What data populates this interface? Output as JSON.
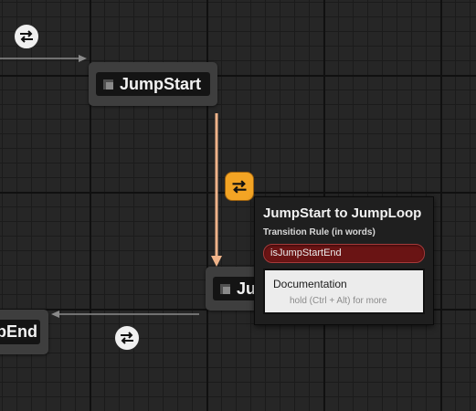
{
  "graph": {
    "background_color": "#262626",
    "wire_color": "#8a8a8a",
    "active_wire_color": "#f0b48a",
    "states": [
      {
        "label": "JumpStart"
      },
      {
        "label": "Ju"
      },
      {
        "label": "pEnd"
      }
    ],
    "transition_icons": [
      {
        "icon": "transition-swap-icon",
        "color": "#f0f0f0"
      },
      {
        "icon": "transition-swap-icon",
        "color": "#f0f0f0"
      },
      {
        "icon": "transition-swap-icon",
        "color": "#f3a424",
        "state": "selected"
      }
    ]
  },
  "tooltip": {
    "title": "JumpStart to JumpLoop",
    "subtitle": "Transition Rule (in words)",
    "rule_text": "isJumpStartEnd",
    "rule_color": "#6a1414",
    "doc_title": "Documentation",
    "doc_hint": "hold (Ctrl + Alt) for more"
  }
}
